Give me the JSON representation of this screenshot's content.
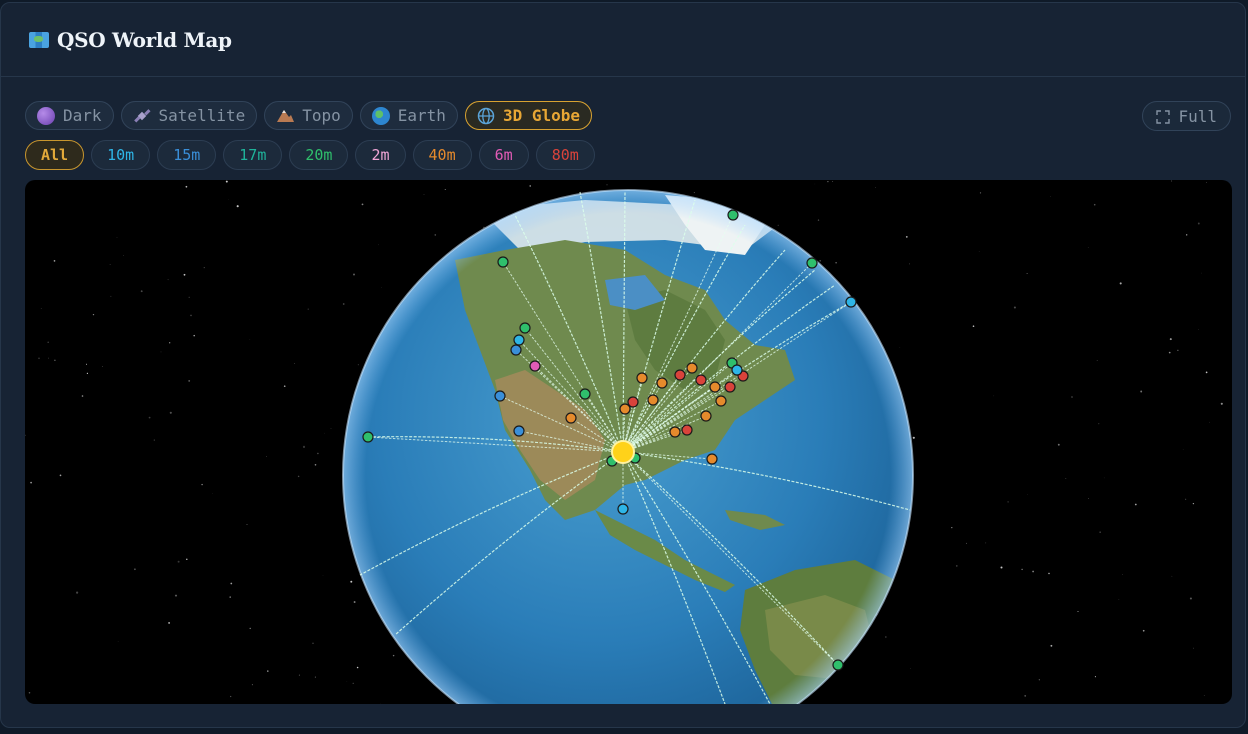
{
  "header": {
    "title": "QSO World Map",
    "icon": "world-map-icon"
  },
  "map_styles": [
    {
      "label": "Dark",
      "icon": "purple-circle-icon",
      "color": "#7a4fc0",
      "active": false
    },
    {
      "label": "Satellite",
      "icon": "satellite-icon",
      "color": "#8a7fb5",
      "active": false
    },
    {
      "label": "Topo",
      "icon": "mountain-icon",
      "color": "#b97a52",
      "active": false
    },
    {
      "label": "Earth",
      "icon": "earth-icon",
      "color": "#3a9ad6",
      "active": false
    },
    {
      "label": "3D Globe",
      "icon": "globe-icon",
      "color": "#5aa3d8",
      "active": true
    }
  ],
  "full_button": {
    "label": "Full",
    "icon": "fullscreen-icon"
  },
  "bands": [
    {
      "label": "All",
      "color": "#e2a93a",
      "active": true
    },
    {
      "label": "10m",
      "color": "#2eb5e6",
      "active": false
    },
    {
      "label": "15m",
      "color": "#3a8fd9",
      "active": false
    },
    {
      "label": "17m",
      "color": "#1fb39a",
      "active": false
    },
    {
      "label": "20m",
      "color": "#2fbf6c",
      "active": false
    },
    {
      "label": "2m",
      "color": "#f0a6d6",
      "active": false
    },
    {
      "label": "40m",
      "color": "#e58a2c",
      "active": false
    },
    {
      "label": "6m",
      "color": "#e25bb6",
      "active": false
    },
    {
      "label": "80m",
      "color": "#d9433b",
      "active": false
    }
  ],
  "colors": {
    "home": "#ffd21a",
    "10m": "#2eb5e6",
    "15m": "#3a8fd9",
    "17m": "#1fb39a",
    "20m": "#2fbf6c",
    "40m": "#e58a2c",
    "80m": "#d9433b",
    "6m": "#e25bb6",
    "2m": "#f0a6d6"
  },
  "globe": {
    "view": "3D Globe",
    "background": "starfield"
  }
}
